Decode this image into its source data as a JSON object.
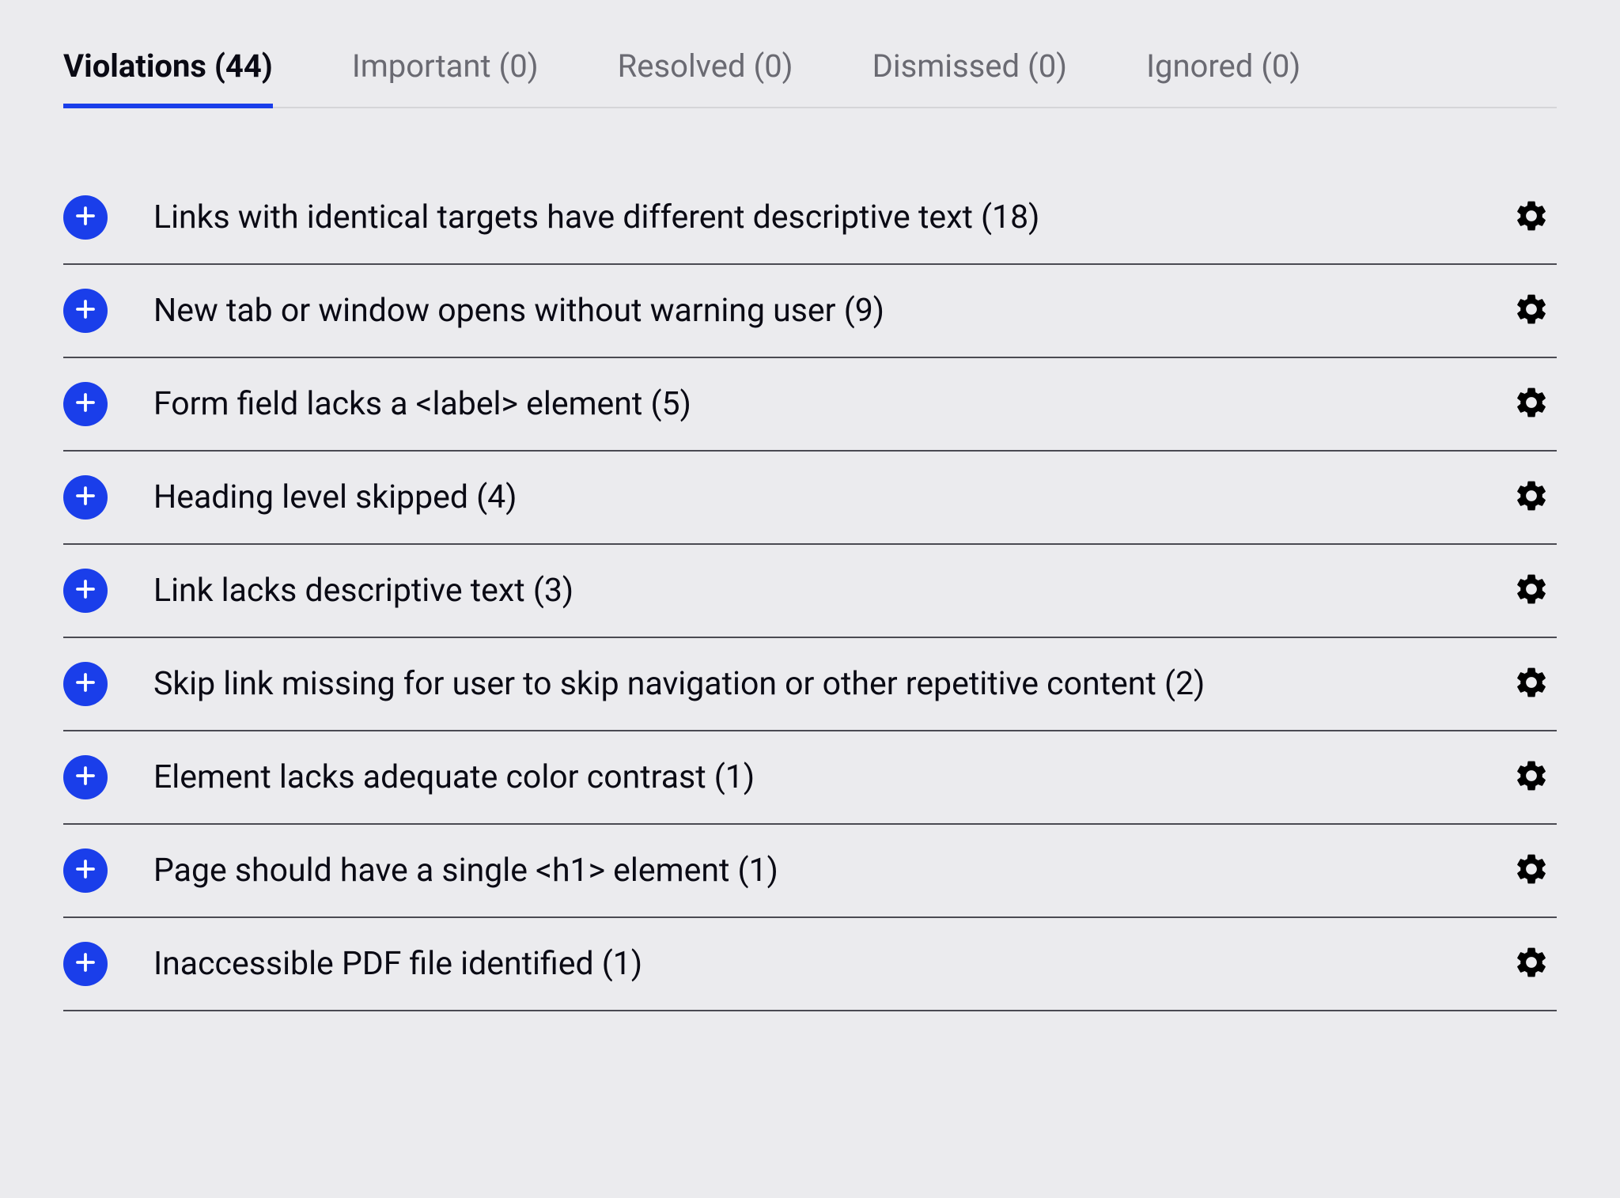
{
  "tabs": [
    {
      "label": "Violations (44)",
      "active": true
    },
    {
      "label": "Important (0)",
      "active": false
    },
    {
      "label": "Resolved (0)",
      "active": false
    },
    {
      "label": "Dismissed (0)",
      "active": false
    },
    {
      "label": "Ignored (0)",
      "active": false
    }
  ],
  "violations": [
    {
      "title": "Links with identical targets have different descriptive text (18)"
    },
    {
      "title": "New tab or window opens without warning user (9)"
    },
    {
      "title": "Form field lacks a <label> element (5)"
    },
    {
      "title": "Heading level skipped (4)"
    },
    {
      "title": "Link lacks descriptive text (3)"
    },
    {
      "title": "Skip link missing for user to skip navigation or other repetitive content (2)"
    },
    {
      "title": "Element lacks adequate color contrast (1)"
    },
    {
      "title": "Page should have a single <h1> element (1)"
    },
    {
      "title": "Inaccessible PDF file identified (1)"
    }
  ]
}
